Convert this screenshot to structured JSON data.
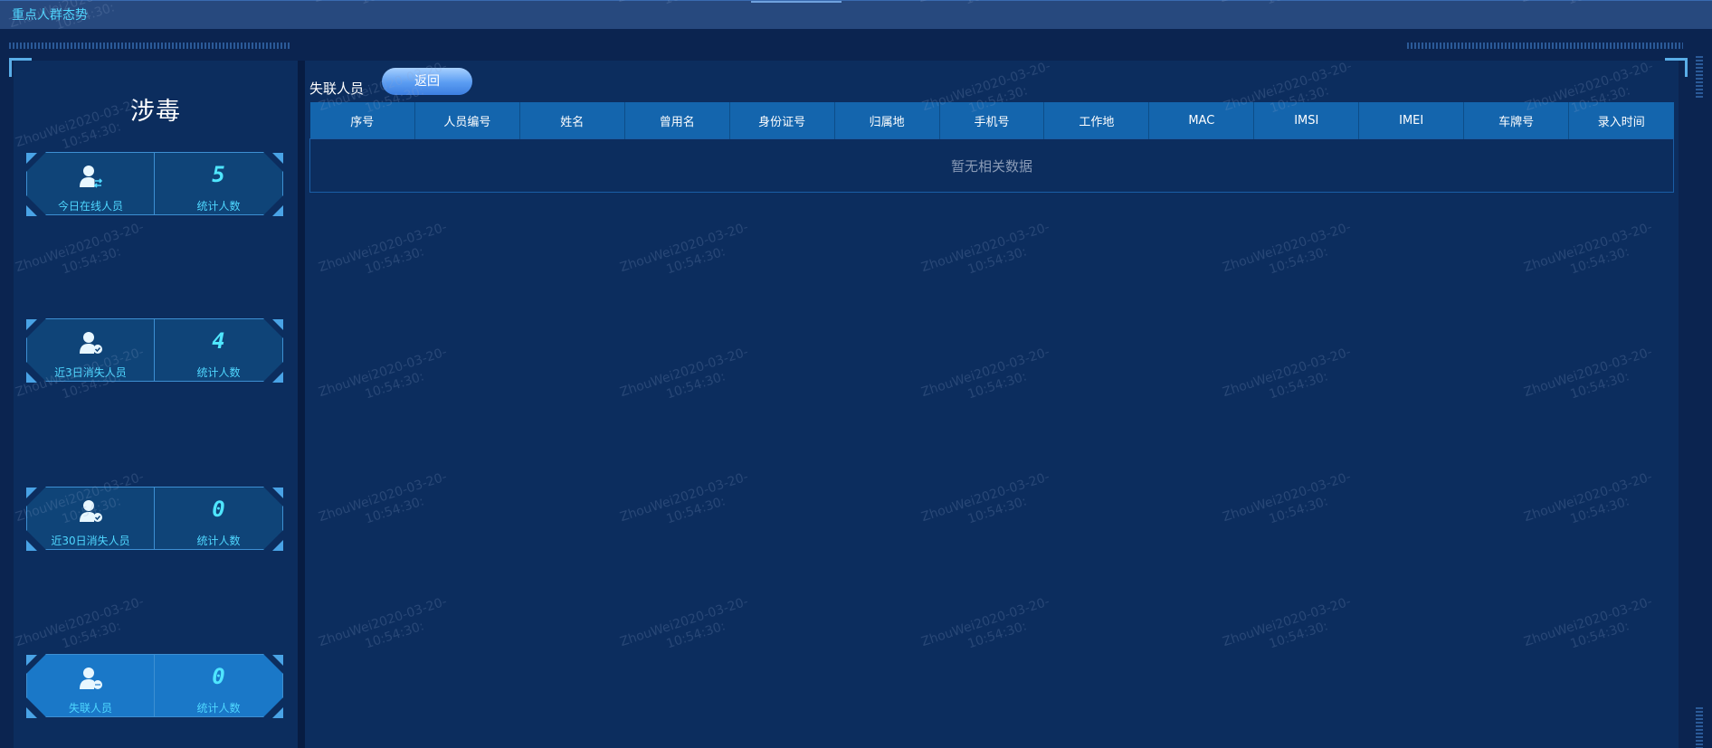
{
  "app_title": "重点人群态势",
  "category_title": "涉毒",
  "stat_cards": [
    {
      "label": "今日在线人员",
      "count": "5",
      "count_label": "统计人数",
      "icon": "person-swap-icon",
      "active": false
    },
    {
      "label": "近3日消失人员",
      "count": "4",
      "count_label": "统计人数",
      "icon": "person-check-icon",
      "active": false
    },
    {
      "label": "近30日消失人员",
      "count": "0",
      "count_label": "统计人数",
      "icon": "person-check-icon",
      "active": false
    },
    {
      "label": "失联人员",
      "count": "0",
      "count_label": "统计人数",
      "icon": "person-lost-icon",
      "active": true
    }
  ],
  "main": {
    "section_title": "失联人员",
    "back_label": "返回",
    "table": {
      "columns": [
        "序号",
        "人员编号",
        "姓名",
        "曾用名",
        "身份证号",
        "归属地",
        "手机号",
        "工作地",
        "MAC",
        "IMSI",
        "IMEI",
        "车牌号",
        "录入时间"
      ],
      "empty_text": "暂无相关数据"
    }
  },
  "watermark": {
    "line1": "ZhouWei2020-03-20-",
    "line2": "10:54:30:"
  },
  "colors": {
    "title_cyan": "#4fd7ff",
    "header_blue": "#1465ad",
    "panel_bg": "#0c2d5e",
    "card_bg": "#0f4478",
    "card_active_bg": "#1a78c8"
  }
}
